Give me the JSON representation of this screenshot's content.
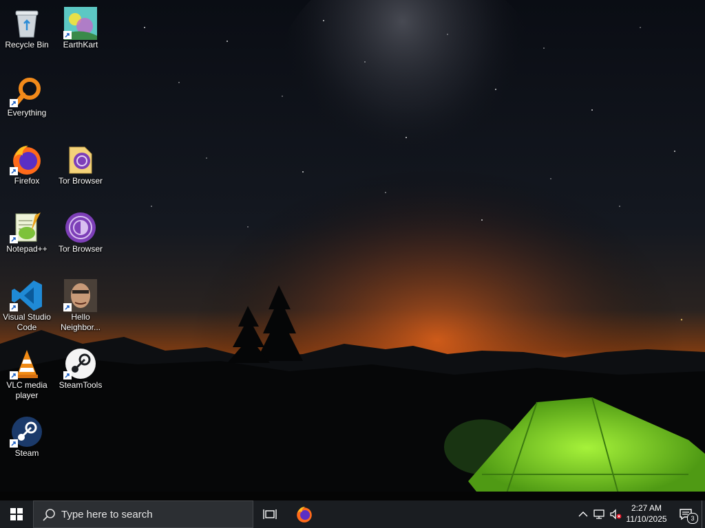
{
  "desktop": {
    "icons": [
      {
        "label": "Recycle Bin",
        "icon": "recycle-bin-icon"
      },
      {
        "label": "EarthKart",
        "icon": "earthkart-icon"
      },
      {
        "label": "Everything",
        "icon": "everything-search-icon"
      },
      {
        "label": "Firefox",
        "icon": "firefox-icon"
      },
      {
        "label": "Tor Browser",
        "icon": "tor-folder-icon"
      },
      {
        "label": "Notepad++",
        "icon": "notepad-plus-plus-icon"
      },
      {
        "label": "Tor Browser",
        "icon": "tor-browser-icon"
      },
      {
        "label": "Visual Studio Code",
        "icon": "vscode-icon"
      },
      {
        "label": "Hello Neighbor...",
        "icon": "hello-neighbor-icon"
      },
      {
        "label": "VLC media player",
        "icon": "vlc-icon"
      },
      {
        "label": "SteamTools",
        "icon": "steamtools-icon"
      },
      {
        "label": "Steam",
        "icon": "steam-icon"
      }
    ]
  },
  "taskbar": {
    "search_placeholder": "Type here to search",
    "pinned": [
      "task-view-icon",
      "firefox-icon"
    ],
    "tray_icons": [
      "chevron-up-icon",
      "network-icon",
      "volume-muted-icon"
    ],
    "time": "2:27 AM",
    "date": "11/10/2025",
    "notification_count": "3",
    "colors": {
      "taskbar": "#1a1d21",
      "search_box": "#2c2f33",
      "accent": "#0078d7"
    }
  }
}
